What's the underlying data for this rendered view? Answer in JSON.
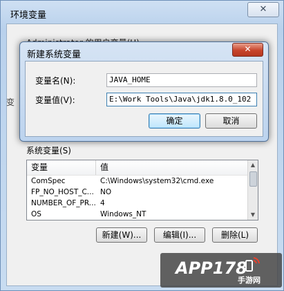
{
  "env_window": {
    "title": "环境变量",
    "close_glyph": "✕",
    "user_vars_peek": "Administrator 的用户变量(U)",
    "left_peek": "变"
  },
  "dialog": {
    "title": "新建系统变量",
    "close_glyph": "✕",
    "name_label": "变量名(N):",
    "value_label": "变量值(V):",
    "name_value": "JAVA_HOME",
    "value_value": "E:\\Work Tools\\Java\\jdk1.8.0_102",
    "ok_label": "确定",
    "cancel_label": "取消"
  },
  "system_vars": {
    "label": "系统变量(S)",
    "columns": [
      "变量",
      "值"
    ],
    "rows": [
      {
        "name": "ComSpec",
        "value": "C:\\Windows\\system32\\cmd.exe"
      },
      {
        "name": "FP_NO_HOST_C...",
        "value": "NO"
      },
      {
        "name": "NUMBER_OF_PR...",
        "value": "4"
      },
      {
        "name": "OS",
        "value": "Windows_NT"
      }
    ],
    "new_label": "新建(W)...",
    "edit_label": "编辑(I)...",
    "delete_label": "删除(L)"
  },
  "watermark": {
    "brand": "APP178",
    "sub": "手游网"
  },
  "colors": {
    "accent": "#3c7fb1",
    "close_red": "#c7442b"
  }
}
